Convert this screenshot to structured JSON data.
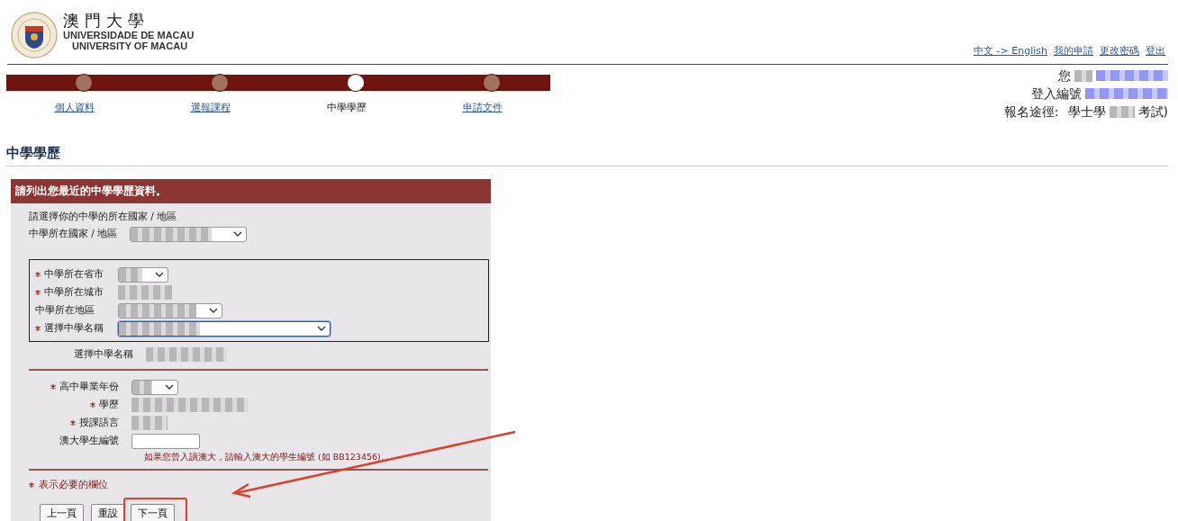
{
  "header": {
    "name_zh": "澳門大學",
    "name_pt": "UNIVERSIDADE DE MACAU",
    "name_en": "UNIVERSITY OF MACAU",
    "links": [
      "中文 -> English",
      "我的申請",
      "更改密碼",
      "登出"
    ]
  },
  "steps": [
    {
      "label": "個人資料",
      "selected": false
    },
    {
      "label": "選報課程",
      "selected": false
    },
    {
      "label": "中學學歷",
      "selected": true
    },
    {
      "label": "申請文件",
      "selected": false
    }
  ],
  "user_info": {
    "greeting": "您",
    "login_label": "登入編號",
    "route_label": "報名途徑:",
    "route_start": "學士學",
    "route_end": "考試)"
  },
  "page_title": "中學學歷",
  "form": {
    "title": "請列出您最近的中學學歷資料。",
    "intro": "請選擇你的中學的所在國家 / 地區",
    "country_field": {
      "label": "中學所在國家 / 地區",
      "required": false,
      "kind": "select"
    },
    "boxed_fields": [
      {
        "label": "中學所在省市",
        "required": true,
        "kind": "select"
      },
      {
        "label": "中學所在城市",
        "required": true,
        "kind": "value"
      },
      {
        "label": "中學所在地區",
        "required": false,
        "kind": "select"
      },
      {
        "label": "選擇中學名稱",
        "required": true,
        "kind": "select"
      }
    ],
    "school_field": {
      "label": "選擇中學名稱",
      "required": false,
      "kind": "value"
    },
    "detail_fields": [
      {
        "label": "高中畢業年份",
        "required": true,
        "kind": "select"
      },
      {
        "label": "學歷",
        "required": true,
        "kind": "value"
      },
      {
        "label": "授課語言",
        "required": true,
        "kind": "value"
      },
      {
        "label": "澳大學生編號",
        "required": false,
        "kind": "input"
      }
    ],
    "hint": "如果您曾入讀澳大，請輸入澳大的學生編號 (如 BB123456)。",
    "required_note": "表示必要的欄位",
    "buttons": [
      {
        "label": "上一頁",
        "highlighted": false
      },
      {
        "label": "重設",
        "highlighted": false
      },
      {
        "label": "下一頁",
        "highlighted": true
      }
    ]
  }
}
